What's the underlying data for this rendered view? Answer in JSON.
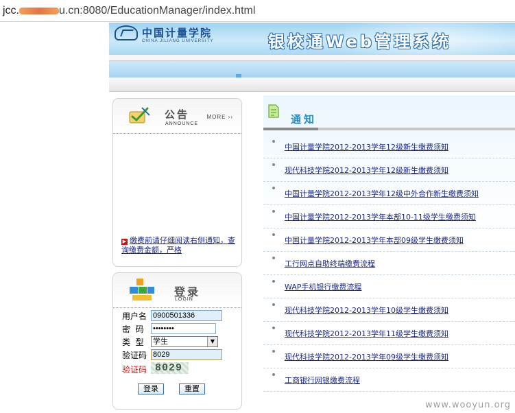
{
  "address_bar": {
    "host": "jcc.",
    "url_rest": "u.cn:8080/EducationManager/index.html"
  },
  "header": {
    "university_cn": "中国计量学院",
    "university_en": "CHINA JILIANG UNIVERSITY",
    "system_title": "银校通Web管理系统"
  },
  "announce": {
    "title_cn": "公告",
    "title_en": "ANNOUNCE",
    "more_label": "MORE ››",
    "link_text": "缴费前请仔细阅读右侧通知，查询缴费金额，严格"
  },
  "login": {
    "title_cn": "登录",
    "title_en": "LOGIN",
    "username_label": "用户名",
    "username_value": "0900501336",
    "password_label": "密  码",
    "password_value": "••••••••",
    "type_label": "类  型",
    "type_value": "学生",
    "code_label": "验证码",
    "code_value": "8029",
    "captcha_label": "验证码",
    "captcha_value": "8029",
    "login_button": "登录",
    "reset_button": "重置"
  },
  "notice": {
    "title": "通知",
    "items": [
      "中国计量学院2012-2013学年12级新生缴费须知",
      "现代科技学院2012-2013学年12级新生缴费须知",
      "中国计量学院2012-2013学年12级中外合作新生缴费须知",
      "中国计量学院2012-2013学年本部10-11级学生缴费须知",
      "中国计量学院2012-2013学年本部09级学生缴费须知",
      "工行网点自助终端缴费流程",
      "WAP手机银行缴费流程",
      "现代科技学院2012-2013学年10级学生缴费须知",
      "现代科技学院2012-2013学年11级学生缴费须知",
      "现代科技学院2012-2013学年09级学生缴费须知",
      "工商银行网银缴费流程"
    ]
  },
  "watermark": "www.wooyun.org",
  "colors": {
    "link": "#1b2a8a",
    "banner": "#9dd2f2",
    "accent_red": "#cc1111"
  }
}
